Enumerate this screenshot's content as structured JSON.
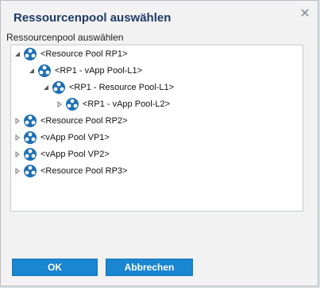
{
  "dialog": {
    "title": "Ressourcenpool auswählen",
    "section_label": "Ressourcenpool auswählen"
  },
  "tree": {
    "items": [
      {
        "label": "<Resource Pool RP1>",
        "expanded": true,
        "icon": "resource-pool-icon"
      },
      {
        "label": "<RP1 - vApp Pool-L1>",
        "expanded": true,
        "icon": "resource-pool-icon"
      },
      {
        "label": "<RP1 - Resource Pool-L1>",
        "expanded": true,
        "icon": "resource-pool-icon"
      },
      {
        "label": "<RP1 - vApp Pool-L2>",
        "expanded": false,
        "icon": "resource-pool-icon"
      },
      {
        "label": "<Resource Pool RP2>",
        "expanded": false,
        "icon": "resource-pool-icon"
      },
      {
        "label": "<vApp Pool VP1>",
        "expanded": false,
        "icon": "resource-pool-icon"
      },
      {
        "label": "<vApp Pool VP2>",
        "expanded": false,
        "icon": "resource-pool-icon"
      },
      {
        "label": "<Resource Pool RP3>",
        "expanded": false,
        "icon": "resource-pool-icon"
      }
    ]
  },
  "buttons": {
    "ok": "OK",
    "cancel": "Abbrechen"
  },
  "colors": {
    "title": "#1f3b65",
    "button": "#1a85d0",
    "icon": "#1f6fb3"
  }
}
